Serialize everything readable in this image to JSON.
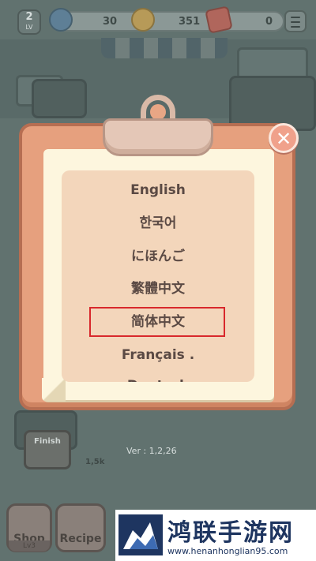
{
  "hud": {
    "level": "2",
    "level_label": "LV",
    "currency_1": "30",
    "currency_2": "351",
    "currency_3": "0"
  },
  "bottom_bar": {
    "shop_label": "Shop",
    "shop_level": "Lv3",
    "recipe_label": "Recipe"
  },
  "scene": {
    "cart_label": "Finish",
    "cost": "1,5k",
    "version": "Ver : 1,2,26"
  },
  "modal": {
    "close_symbol": "✕",
    "languages": [
      "English",
      "한국어",
      "にほんご",
      "繁體中文",
      "简体中文",
      "Français .",
      "Deutsch"
    ],
    "highlighted_language": "简体中文"
  },
  "watermark": {
    "title": "鸿联手游网",
    "url": "www.henanhonglian95.com"
  }
}
